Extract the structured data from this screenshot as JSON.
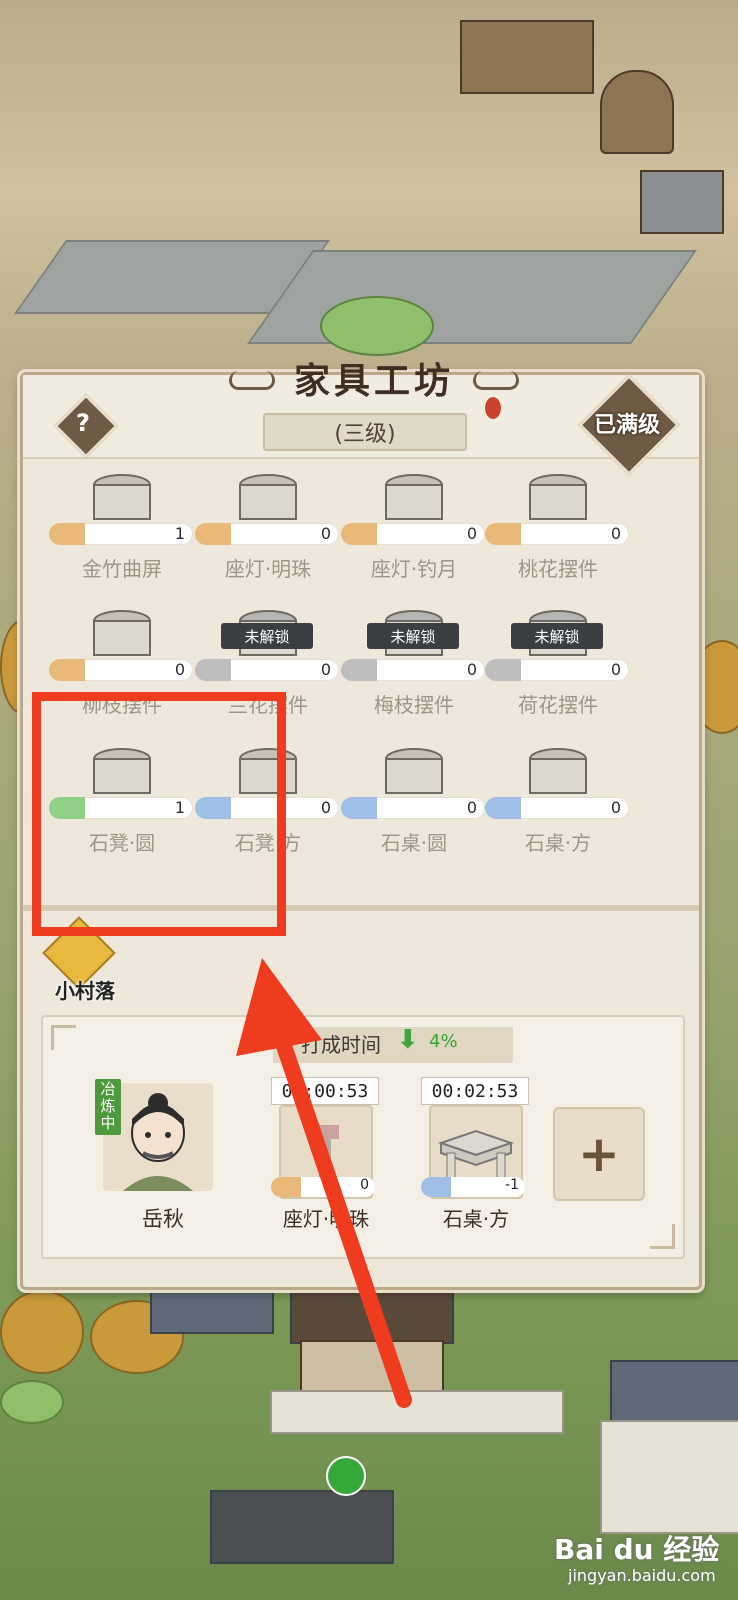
{
  "panel": {
    "title": "家具工坊",
    "level": "(三级)",
    "help_label": "?",
    "max_level_label": "已满级"
  },
  "items": [
    {
      "name": "金竹曲屏",
      "count": "1",
      "locked": false,
      "tint": "#e9b979"
    },
    {
      "name": "座灯·明珠",
      "count": "0",
      "locked": false,
      "tint": "#e9b979"
    },
    {
      "name": "座灯·钓月",
      "count": "0",
      "locked": false,
      "tint": "#e9b979"
    },
    {
      "name": "桃花摆件",
      "count": "0",
      "locked": false,
      "tint": "#e9b979"
    },
    {
      "name": "柳枝摆件",
      "count": "0",
      "locked": false,
      "tint": "#e9b979"
    },
    {
      "name": "兰花摆件",
      "count": "0",
      "locked": true,
      "tint": "#bdbdbd"
    },
    {
      "name": "梅枝摆件",
      "count": "0",
      "locked": true,
      "tint": "#bdbdbd"
    },
    {
      "name": "荷花摆件",
      "count": "0",
      "locked": true,
      "tint": "#bdbdbd"
    },
    {
      "name": "石凳·圆",
      "count": "1",
      "locked": false,
      "tint": "#8fcf86"
    },
    {
      "name": "石凳·方",
      "count": "0",
      "locked": false,
      "tint": "#9fbfe6"
    },
    {
      "name": "石桌·圆",
      "count": "0",
      "locked": false,
      "tint": "#9fbfe6"
    },
    {
      "name": "石桌·方",
      "count": "0",
      "locked": false,
      "tint": "#9fbfe6"
    }
  ],
  "lock_label": "未解锁",
  "tier": {
    "label": "小村落"
  },
  "craft": {
    "speed_label": "打成时间",
    "speed_value": "4%",
    "worker": {
      "name": "岳秋",
      "status": "冶炼中"
    },
    "queue": [
      {
        "timer": "00:00:53",
        "name": "座灯·明珠",
        "count": "0",
        "tint": "#e9b979"
      },
      {
        "timer": "00:02:53",
        "name": "石桌·方",
        "count": "-1",
        "tint": "#9fbfe6"
      }
    ],
    "add_label": "+"
  },
  "watermark": {
    "brand": "Bai du 经验",
    "url": "jingyan.baidu.com"
  }
}
